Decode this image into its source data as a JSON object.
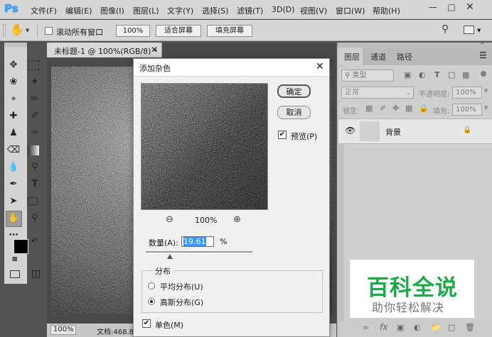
{
  "app": {
    "logo": "Ps"
  },
  "menu": [
    "文件(F)",
    "编辑(E)",
    "图像(I)",
    "图层(L)",
    "文字(Y)",
    "选择(S)",
    "滤镜(T)",
    "3D(D)",
    "视图(V)",
    "窗口(W)",
    "帮助(H)"
  ],
  "options_bar": {
    "scroll_all_label": "滚动所有窗口",
    "zoom_value": "100%",
    "fit_screen": "适合屏幕",
    "fill_screen": "填充屏幕"
  },
  "document": {
    "tab_title": "未标题-1 @ 100%(RGB/8) *",
    "status_zoom": "100%",
    "status_text": "文档:468.8"
  },
  "panels": {
    "tabs": [
      "图层",
      "通道",
      "路径"
    ],
    "kind_filter": "类型",
    "blend_mode": "正常",
    "opacity_label": "不透明度:",
    "opacity_value": "100%",
    "lock_label": "锁定:",
    "fill_label": "填充:",
    "fill_value": "100%",
    "layer_name": "背景"
  },
  "dialog": {
    "title": "添加杂色",
    "ok": "确定",
    "cancel": "取消",
    "preview_label": "预览(P)",
    "preview_checked": true,
    "zoom": "100%",
    "amount_label": "数量(A):",
    "amount_value": "19.61",
    "amount_unit": "%",
    "amount_fraction": 0.1961,
    "distribution_label": "分布",
    "uniform_label": "平均分布(U)",
    "gaussian_label": "高斯分布(G)",
    "selected_distribution": "gaussian",
    "monochrome_label": "单色(M)",
    "monochrome_checked": true
  },
  "watermark": {
    "title": "百科全说",
    "subtitle": "助你轻松解决",
    "color": "#1fa84a"
  },
  "colors": {
    "accent": "#31a8ff"
  }
}
